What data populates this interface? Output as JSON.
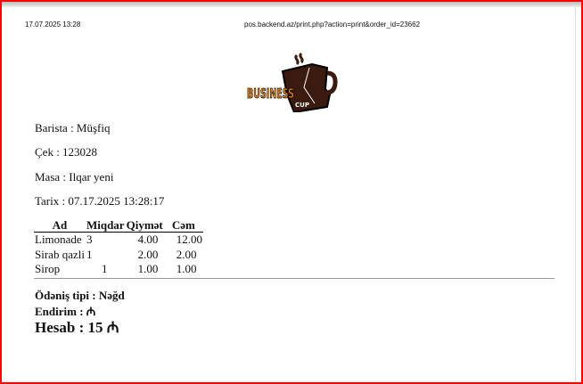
{
  "print_header": {
    "datetime": "17.07.2025 13:28",
    "url": "pos.backend.az/print.php?action=print&order_id=23662"
  },
  "logo": {
    "text1": "BUSINESS",
    "text2": "CUP"
  },
  "receipt": {
    "barista": "Barista : Müşfiq",
    "check": "Çek : 123028",
    "table": "Masa : Ilqar yeni",
    "date": "Tarix : 07.17.2025 13:28:17",
    "columns": [
      "Ad",
      "Miqdar",
      "Qiymət",
      "Cəm"
    ],
    "items": [
      {
        "name": "Limonade",
        "qty": "3",
        "price": "4.00",
        "total": "12.00"
      },
      {
        "name": "Sirab qazli",
        "qty": "1",
        "price": "2.00",
        "total": "2.00"
      },
      {
        "name": "Sirop",
        "qty": "1",
        "price": "1.00",
        "total": "1.00"
      }
    ],
    "payment": "Ödəniş tipi : Nəğd",
    "discount": "Endirim : ₼",
    "total": "Hesab : 15 ₼"
  }
}
